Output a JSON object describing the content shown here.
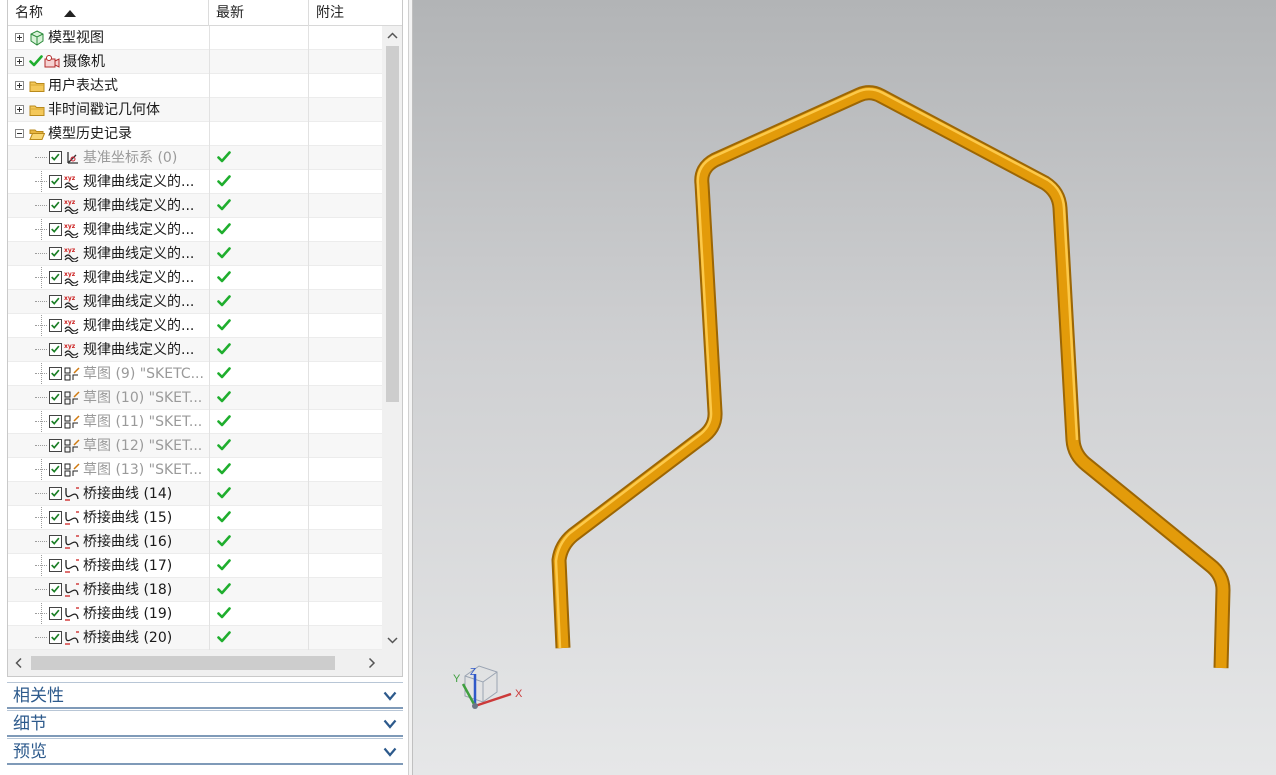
{
  "navigator": {
    "columns": {
      "name": "名称",
      "latest": "最新",
      "note": "附注"
    },
    "top_nodes": [
      {
        "label": "模型视图",
        "icon": "model-views-icon",
        "expander": "plus"
      },
      {
        "label": "摄像机",
        "icon": "camera-icon",
        "expander": "plus"
      },
      {
        "label": "用户表达式",
        "icon": "folder-icon",
        "expander": "plus"
      },
      {
        "label": "非时间戳记几何体",
        "icon": "folder-icon",
        "expander": "plus"
      },
      {
        "label": "模型历史记录",
        "icon": "folder-open-icon",
        "expander": "minus"
      }
    ],
    "history": [
      {
        "label": "基准坐标系 (0)",
        "icon": "datum-csys-icon",
        "dim": true
      },
      {
        "label": "规律曲线定义的...",
        "icon": "law-curve-icon",
        "dim": false
      },
      {
        "label": "规律曲线定义的...",
        "icon": "law-curve-icon",
        "dim": false
      },
      {
        "label": "规律曲线定义的...",
        "icon": "law-curve-icon",
        "dim": false
      },
      {
        "label": "规律曲线定义的...",
        "icon": "law-curve-icon",
        "dim": false
      },
      {
        "label": "规律曲线定义的...",
        "icon": "law-curve-icon",
        "dim": false
      },
      {
        "label": "规律曲线定义的...",
        "icon": "law-curve-icon",
        "dim": false
      },
      {
        "label": "规律曲线定义的...",
        "icon": "law-curve-icon",
        "dim": false
      },
      {
        "label": "规律曲线定义的...",
        "icon": "law-curve-icon",
        "dim": false
      },
      {
        "label": "草图 (9) \"SKETC...",
        "icon": "sketch-icon",
        "dim": true
      },
      {
        "label": "草图 (10) \"SKET...",
        "icon": "sketch-icon",
        "dim": true
      },
      {
        "label": "草图 (11) \"SKET...",
        "icon": "sketch-icon",
        "dim": true
      },
      {
        "label": "草图 (12) \"SKET...",
        "icon": "sketch-icon",
        "dim": true
      },
      {
        "label": "草图 (13) \"SKET...",
        "icon": "sketch-icon",
        "dim": true
      },
      {
        "label": "桥接曲线 (14)",
        "icon": "bridge-curve-icon",
        "dim": false
      },
      {
        "label": "桥接曲线 (15)",
        "icon": "bridge-curve-icon",
        "dim": false
      },
      {
        "label": "桥接曲线 (16)",
        "icon": "bridge-curve-icon",
        "dim": false
      },
      {
        "label": "桥接曲线 (17)",
        "icon": "bridge-curve-icon",
        "dim": false
      },
      {
        "label": "桥接曲线 (18)",
        "icon": "bridge-curve-icon",
        "dim": false
      },
      {
        "label": "桥接曲线 (19)",
        "icon": "bridge-curve-icon",
        "dim": false
      },
      {
        "label": "桥接曲线 (20)",
        "icon": "bridge-curve-icon",
        "dim": false
      }
    ]
  },
  "panels": {
    "dependencies": "相关性",
    "details": "细节",
    "preview": "预览"
  },
  "triad": {
    "x": "X",
    "y": "Y",
    "z": "Z"
  },
  "colors": {
    "tube": "#e9a20c",
    "tube_dark": "#b87a05",
    "check": "#1fae2e",
    "panel_text": "#2d5a8c"
  }
}
